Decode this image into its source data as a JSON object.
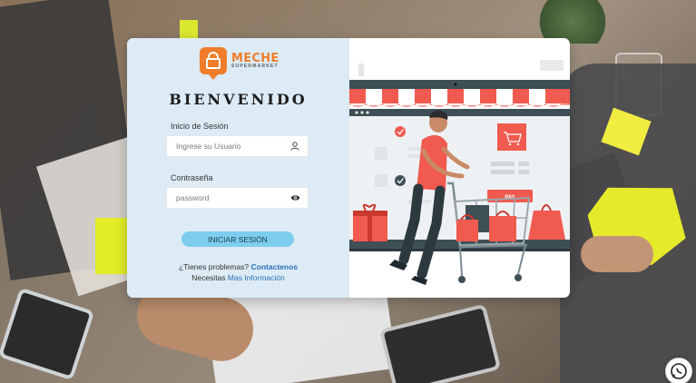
{
  "brand": {
    "name": "MECHE",
    "sub": "SUPERMARKET",
    "color": "#ef7d2c"
  },
  "login": {
    "title": "BIENVENIDO",
    "user_label": "Inicio de Sesión",
    "user_placeholder": "Ingrese su Usuario",
    "user_icon": "user-icon",
    "pass_label": "Contraseña",
    "pass_placeholder": "password",
    "pass_icon": "eye-icon",
    "submit_label": "INICIAR SESIÓN",
    "help_text": "¿Tienes problemas?",
    "help_link": "Contactenos",
    "info_text": "Necesitas",
    "info_link": "Mas Información"
  },
  "illustration": {
    "pay_label": "PAY"
  },
  "colors": {
    "panel_left": "#dcebf5",
    "button": "#7dcdee",
    "link": "#2d6fb7",
    "accent_red": "#f05a4f",
    "dark_teal": "#3e4f56"
  },
  "fab": {
    "icon": "whatsapp-icon"
  }
}
